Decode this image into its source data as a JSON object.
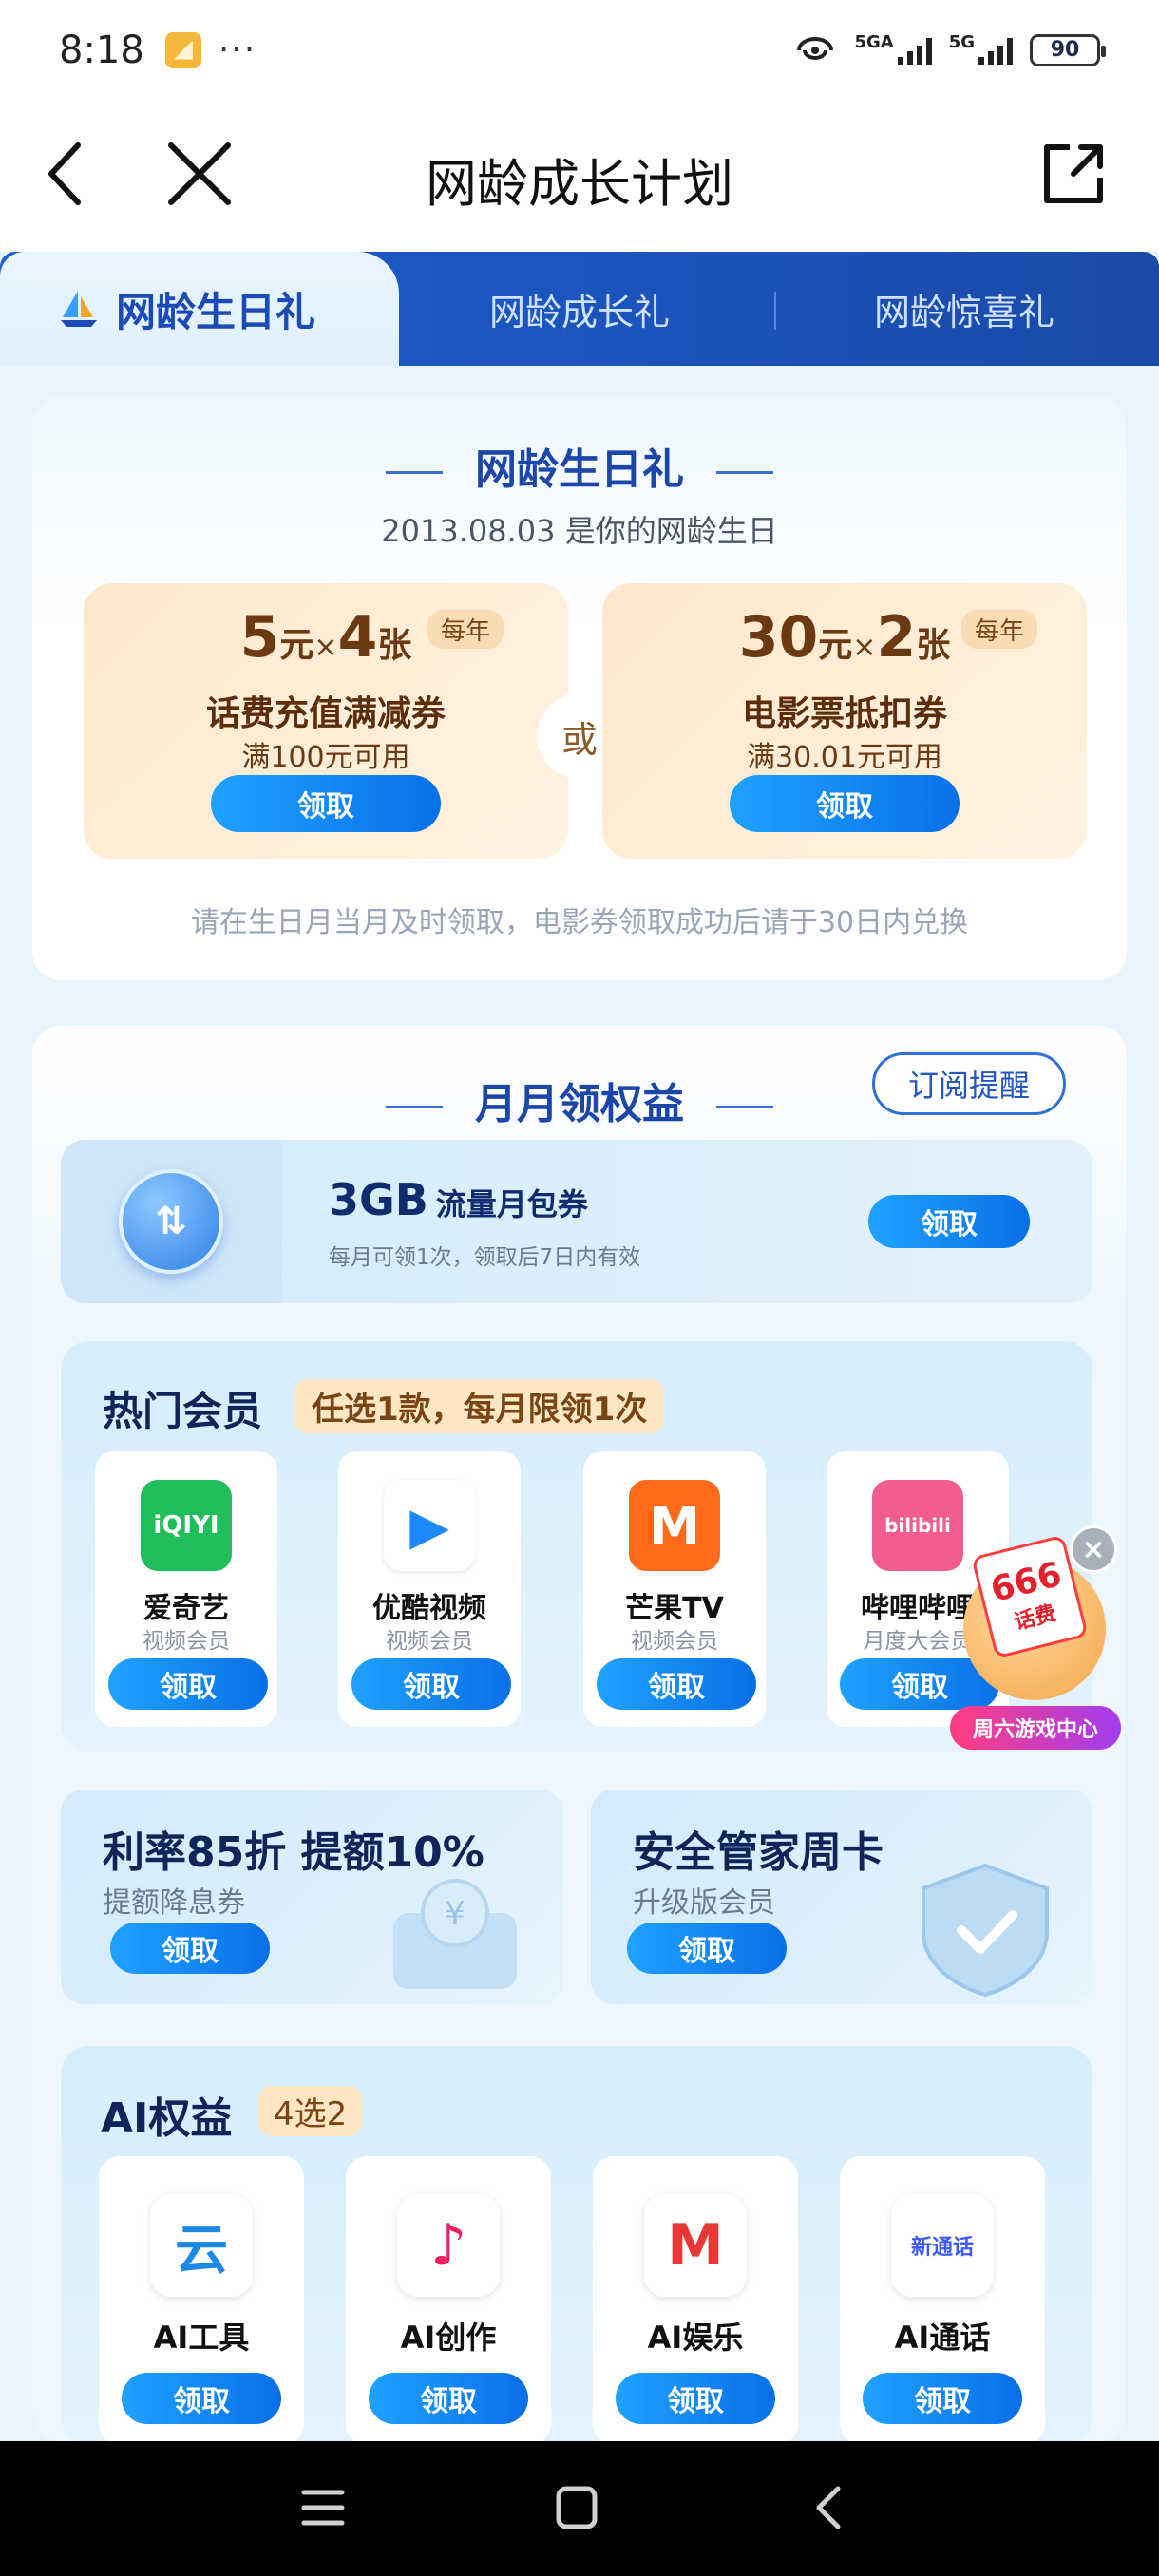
{
  "status_bar": {
    "time": "8:18",
    "dots": "···",
    "sig1_label": "5GA",
    "sig2_label": "5G",
    "battery": "90"
  },
  "nav": {
    "title": "网龄成长计划"
  },
  "tabs": [
    {
      "label": "网龄生日礼",
      "active": true
    },
    {
      "label": "网龄成长礼",
      "active": false
    },
    {
      "label": "网龄惊喜礼",
      "active": false
    }
  ],
  "birthday": {
    "title": "网龄生日礼",
    "subtitle": "2013.08.03 是你的网龄生日",
    "or_label": "或",
    "note": "请在生日月当月及时领取，电影券领取成功后请于30日内兑换",
    "coupons": [
      {
        "amount": "5",
        "unit": "元",
        "times": "×",
        "count": "4",
        "count_unit": "张",
        "tag": "每年",
        "name": "话费充值满减券",
        "condition": "满100元可用",
        "button": "领取"
      },
      {
        "amount": "30",
        "unit": "元",
        "times": "×",
        "count": "2",
        "count_unit": "张",
        "tag": "每年",
        "name": "电影票抵扣券",
        "condition": "满30.01元可用",
        "button": "领取"
      }
    ]
  },
  "monthly": {
    "title": "月月领权益",
    "subscribe": "订阅提醒",
    "flow": {
      "amount": "3GB",
      "name": "流量月包券",
      "desc": "每月可领1次，领取后7日内有效",
      "button": "领取",
      "icon_symbol": "⇅"
    }
  },
  "hot_vip": {
    "title": "热门会员",
    "badge": "任选1款，每月限领1次",
    "items": [
      {
        "name": "爱奇艺",
        "sub": "视频会员",
        "button": "领取",
        "logo_text": "iQIYI",
        "color": "#1fbe5a"
      },
      {
        "name": "优酷视频",
        "sub": "视频会员",
        "button": "领取",
        "logo_text": "▶",
        "color": "#ffffff"
      },
      {
        "name": "芒果TV",
        "sub": "视频会员",
        "button": "领取",
        "logo_text": "M",
        "color": "#ff6a1a"
      },
      {
        "name": "哔哩哔哩",
        "sub": "月度大会员",
        "button": "领取",
        "logo_text": "bilibili",
        "color": "#f25d8e"
      }
    ]
  },
  "float_ad": {
    "amount": "666",
    "tag": "话费",
    "label": "周六游戏中心"
  },
  "promos": [
    {
      "title": "利率85折 提额10%",
      "sub": "提额降息券",
      "button": "领取"
    },
    {
      "title": "安全管家周卡",
      "sub": "升级版会员",
      "button": "领取"
    }
  ],
  "ai": {
    "title": "AI权益",
    "badge": "4选2",
    "items": [
      {
        "name": "AI工具",
        "button": "领取",
        "logo_text": "云",
        "color": "#1e88e5"
      },
      {
        "name": "AI创作",
        "button": "领取",
        "logo_text": "♪",
        "color": "#e91e63"
      },
      {
        "name": "AI娱乐",
        "button": "领取",
        "logo_text": "M",
        "color": "#e53935"
      },
      {
        "name": "AI通话",
        "button": "领取",
        "logo_text": "新通话",
        "color": "#3d5afe"
      }
    ]
  },
  "colors": {
    "accent": "#0a6fe8",
    "tab_bar": "#1c5fd2",
    "coupon_bg": "#fde8cc",
    "coupon_text": "#6b3a12"
  }
}
